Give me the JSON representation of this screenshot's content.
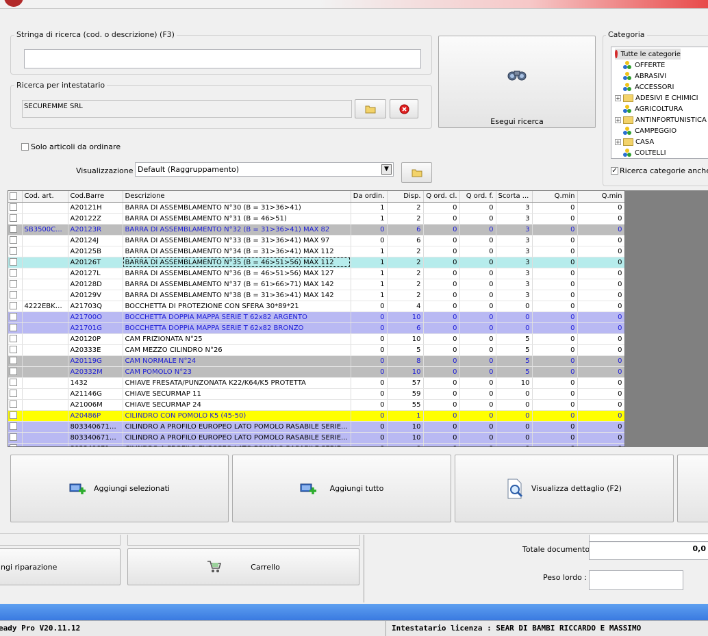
{
  "search": {
    "label": "Stringa di ricerca (cod. o descrizione) (F3)",
    "value": ""
  },
  "holder": {
    "label": "Ricerca per intestatario",
    "value": "SECUREMME SRL"
  },
  "exec_button": "Esegui ricerca",
  "only_to_order": "Solo articoli da ordinare",
  "view": {
    "label": "Visualizzazione :",
    "value": "Default (Raggruppamento)"
  },
  "category": {
    "label": "Categoria",
    "items": [
      {
        "label": "Tutte le categorie",
        "icon": "strawberry-icon",
        "expandable": false
      },
      {
        "label": "OFFERTE",
        "icon": "category-icon",
        "expandable": false
      },
      {
        "label": "ABRASIVI",
        "icon": "category-icon",
        "expandable": false
      },
      {
        "label": "ACCESSORI",
        "icon": "category-icon",
        "expandable": false
      },
      {
        "label": "ADESIVI E CHIMICI",
        "icon": "folder-icon",
        "expandable": true
      },
      {
        "label": "AGRICOLTURA",
        "icon": "category-icon",
        "expandable": false
      },
      {
        "label": "ANTINFORTUNISTICA",
        "icon": "folder-icon",
        "expandable": true
      },
      {
        "label": "CAMPEGGIO",
        "icon": "category-icon",
        "expandable": false
      },
      {
        "label": "CASA",
        "icon": "folder-icon",
        "expandable": true
      },
      {
        "label": "COLTELLI",
        "icon": "category-icon",
        "expandable": false
      }
    ],
    "subcat_checkbox": "Ricerca categorie anche su"
  },
  "grid": {
    "headers": [
      "Cod. art.",
      "Cod.Barre",
      "Descrizione",
      "Da ordin.",
      "Disp.",
      "Q ord. cl.",
      "Q ord. f.",
      "Scorta ...",
      "Q.min",
      "Q.min"
    ],
    "rows": [
      {
        "style": "",
        "cells": [
          "",
          "A20121H",
          "BARRA DI ASSEMBLAMENTO N°30 (B = 31>36>41)",
          "1",
          "2",
          "0",
          "0",
          "3",
          "0",
          "0"
        ]
      },
      {
        "style": "",
        "cells": [
          "",
          "A20122Z",
          "BARRA DI ASSEMBLAMENTO N°31 (B = 46>51)",
          "1",
          "2",
          "0",
          "0",
          "3",
          "0",
          "0"
        ]
      },
      {
        "style": "r-gray blue",
        "cells": [
          "SB3500C...",
          "A20123R",
          "BARRA DI ASSEMBLAMENTO N°32 (B = 31>36>41) MAX 82",
          "0",
          "6",
          "0",
          "0",
          "3",
          "0",
          "0"
        ]
      },
      {
        "style": "",
        "cells": [
          "",
          "A20124J",
          "BARRA DI ASSEMBLAMENTO N°33 (B = 31>36>41) MAX 97",
          "0",
          "6",
          "0",
          "0",
          "3",
          "0",
          "0"
        ]
      },
      {
        "style": "",
        "cells": [
          "",
          "A20125B",
          "BARRA DI ASSEMBLAMENTO N°34 (B = 31>36>41) MAX 112",
          "1",
          "2",
          "0",
          "0",
          "3",
          "0",
          "0"
        ]
      },
      {
        "style": "r-cyan",
        "cells": [
          "",
          "A20126T",
          "BARRA DI ASSEMBLAMENTO N°35 (B = 46>51>56) MAX 112",
          "1",
          "2",
          "0",
          "0",
          "3",
          "0",
          "0"
        ]
      },
      {
        "style": "",
        "cells": [
          "",
          "A20127L",
          "BARRA DI ASSEMBLAMENTO N°36 (B = 46>51>56) MAX 127",
          "1",
          "2",
          "0",
          "0",
          "3",
          "0",
          "0"
        ]
      },
      {
        "style": "",
        "cells": [
          "",
          "A20128D",
          "BARRA DI ASSEMBLAMENTO N°37 (B = 61>66>71) MAX 142",
          "1",
          "2",
          "0",
          "0",
          "3",
          "0",
          "0"
        ]
      },
      {
        "style": "",
        "cells": [
          "",
          "A20129V",
          "BARRA DI ASSEMBLAMENTO N°38 (B = 31>36>41) MAX 142",
          "1",
          "2",
          "0",
          "0",
          "3",
          "0",
          "0"
        ]
      },
      {
        "style": "",
        "cells": [
          "4222EBK2...",
          "A21703Q",
          "BOCCHETTA DI PROTEZIONE CON SFERA 30*89*21",
          "0",
          "4",
          "0",
          "0",
          "0",
          "0",
          "0"
        ]
      },
      {
        "style": "r-blue blue",
        "cells": [
          "",
          "A21700O",
          "BOCCHETTA DOPPIA MAPPA SERIE  T 62x82 ARGENTO",
          "0",
          "10",
          "0",
          "0",
          "0",
          "0",
          "0"
        ]
      },
      {
        "style": "r-blue blue",
        "cells": [
          "",
          "A21701G",
          "BOCCHETTA DOPPIA MAPPA SERIE  T 62x82 BRONZO",
          "0",
          "6",
          "0",
          "0",
          "0",
          "0",
          "0"
        ]
      },
      {
        "style": "",
        "cells": [
          "",
          "A20120P",
          "CAM FRIZIONATA N°25",
          "0",
          "10",
          "0",
          "0",
          "5",
          "0",
          "0"
        ]
      },
      {
        "style": "",
        "cells": [
          "",
          "A20333E",
          "CAM MEZZO CILINDRO N°26",
          "0",
          "5",
          "0",
          "0",
          "5",
          "0",
          "0"
        ]
      },
      {
        "style": "r-gray blue",
        "cells": [
          "",
          "A20119G",
          "CAM NORMALE N°24",
          "0",
          "8",
          "0",
          "0",
          "5",
          "0",
          "0"
        ]
      },
      {
        "style": "r-gray blue",
        "cells": [
          "",
          "A20332M",
          "CAM POMOLO N°23",
          "0",
          "10",
          "0",
          "0",
          "5",
          "0",
          "0"
        ]
      },
      {
        "style": "",
        "cells": [
          "",
          "1432",
          "CHIAVE FRESATA/PUNZONATA K22/K64/K5 PROTETTA",
          "0",
          "57",
          "0",
          "0",
          "10",
          "0",
          "0"
        ]
      },
      {
        "style": "",
        "cells": [
          "",
          "A21146G",
          "CHIAVE SECURMAP 11",
          "0",
          "59",
          "0",
          "0",
          "0",
          "0",
          "0"
        ]
      },
      {
        "style": "",
        "cells": [
          "",
          "A21006M",
          "CHIAVE SECURMAP 24",
          "0",
          "55",
          "0",
          "0",
          "0",
          "0",
          "0"
        ]
      },
      {
        "style": "r-yellow blue",
        "cells": [
          "",
          "A20486P",
          "CILINDRO CON POMOLO K5 (45-50)",
          "0",
          "1",
          "0",
          "0",
          "0",
          "0",
          "0"
        ]
      },
      {
        "style": "r-blue",
        "cells": [
          "",
          "8033406710...",
          "CILINDRO A PROFILO EUROPEO LATO POMOLO RASABILE SERIE...",
          "0",
          "10",
          "0",
          "0",
          "0",
          "0",
          "0"
        ]
      },
      {
        "style": "r-blue",
        "cells": [
          "",
          "8033406711...",
          "CILINDRO A PROFILO EUROPEO LATO POMOLO RASABILE SERIE...",
          "0",
          "10",
          "0",
          "0",
          "0",
          "0",
          "0"
        ]
      },
      {
        "style": "r-blue",
        "cells": [
          "",
          "8033406712...",
          "CILINDRO A PROFILO EUROPEO LATO POMOLO RASABILE SERIE...",
          "0",
          "0",
          "0",
          "0",
          "0",
          "0",
          "0"
        ]
      }
    ]
  },
  "actions": {
    "add_selected": "Aggiungi selezionati",
    "add_all": "Aggiungi tutto",
    "view_detail": "Visualizza dettaglio (F2)"
  },
  "bottom": {
    "repair": "ngi riparazione",
    "cart": "Carrello",
    "total_label": "Totale documento :",
    "total_value": "0,0",
    "weight_label": "Peso lordo :",
    "weight_value": ""
  },
  "status": {
    "version": "eady Pro V20.11.12",
    "license": "Intestatario licenza : SEAR DI BAMBI RICCARDO E MASSIMO"
  },
  "colors": {
    "selection_blue": "#3a7ae0",
    "row_purple": "#b9b9f3",
    "row_yellow": "#ffff00"
  }
}
